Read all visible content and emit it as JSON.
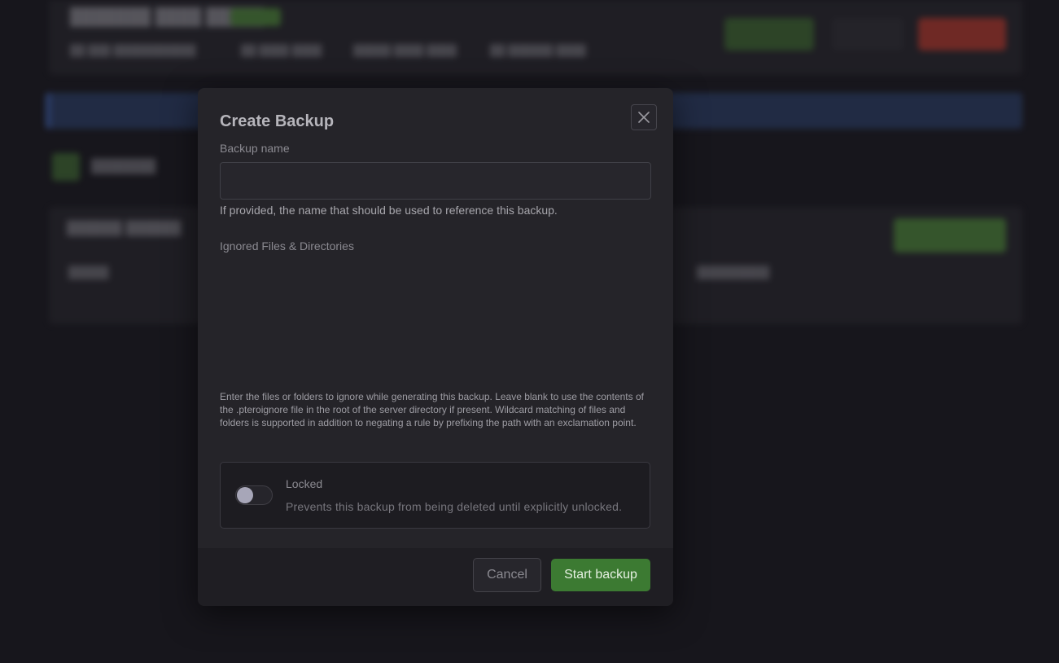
{
  "modal": {
    "title": "Create Backup",
    "close_icon": "close-icon",
    "backup_name": {
      "label": "Backup name",
      "value": "",
      "placeholder": "",
      "help": "If provided, the name that should be used to reference this backup."
    },
    "ignored": {
      "label": "Ignored Files & Directories",
      "value": "",
      "help": "Enter the files or folders to ignore while generating this backup. Leave blank to use the contents of the .pteroignore file in the root of the server directory if present. Wildcard matching of files and folders is supported in addition to negating a rule by prefixing the path with an exclamation point."
    },
    "locked": {
      "title": "Locked",
      "description": "Prevents this backup from being deleted until explicitly unlocked.",
      "enabled": false
    },
    "footer": {
      "cancel_label": "Cancel",
      "start_label": "Start backup"
    }
  },
  "colors": {
    "accent_green": "#3c7a32",
    "danger_red": "#b83a2e",
    "notice_blue": "#2a3d66",
    "modal_bg": "#252429"
  }
}
